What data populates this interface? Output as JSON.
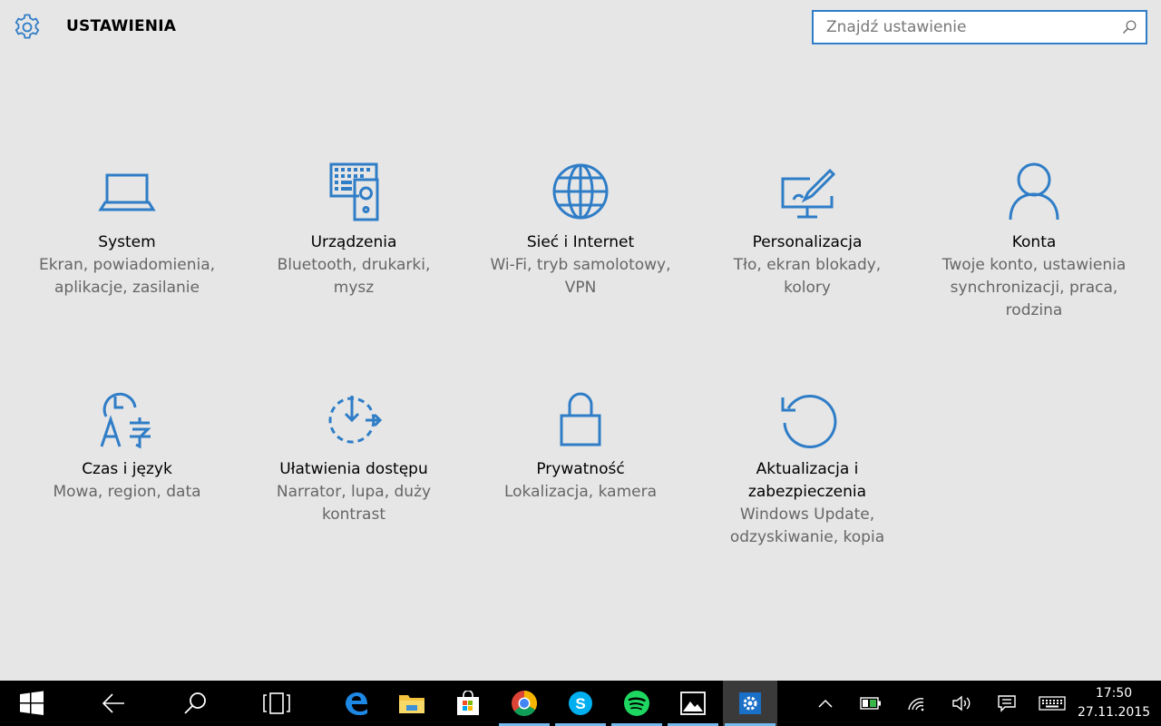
{
  "header": {
    "title": "USTAWIENIA",
    "search_placeholder": "Znajdź ustawienie"
  },
  "colors": {
    "accent": "#2f7dc7",
    "background": "#e6e6e6",
    "taskbar": "#000000",
    "active_indicator": "#76b9ed"
  },
  "categories": [
    {
      "name": "System",
      "desc1": "Ekran, powiadomienia,",
      "desc2": "aplikacje, zasilanie",
      "desc3": "",
      "icon": "laptop-icon"
    },
    {
      "name": "Urządzenia",
      "desc1": "Bluetooth, drukarki,",
      "desc2": "mysz",
      "desc3": "",
      "icon": "devices-icon"
    },
    {
      "name": "Sieć i Internet",
      "desc1": "Wi-Fi, tryb samolotowy,",
      "desc2": "VPN",
      "desc3": "",
      "icon": "globe-icon"
    },
    {
      "name": "Personalizacja",
      "desc1": "Tło, ekran blokady,",
      "desc2": "kolory",
      "desc3": "",
      "icon": "personalize-icon"
    },
    {
      "name": "Konta",
      "desc1": "Twoje konto, ustawienia",
      "desc2": "synchronizacji, praca,",
      "desc3": "rodzina",
      "icon": "person-icon"
    },
    {
      "name": "Czas i język",
      "desc1": "Mowa, region, data",
      "desc2": "",
      "desc3": "",
      "icon": "time-language-icon"
    },
    {
      "name": "Ułatwienia dostępu",
      "desc1": "Narrator, lupa, duży",
      "desc2": "kontrast",
      "desc3": "",
      "icon": "ease-of-access-icon"
    },
    {
      "name": "Prywatność",
      "desc1": "Lokalizacja, kamera",
      "desc2": "",
      "desc3": "",
      "icon": "lock-icon"
    },
    {
      "name1": "Aktualizacja i",
      "name2": "zabezpieczenia",
      "desc1": "Windows Update,",
      "desc2": "odzyskiwanie, kopia",
      "desc3": "",
      "icon": "update-icon"
    }
  ],
  "taskbar": {
    "apps": [
      "start-icon",
      "back-icon",
      "search-icon",
      "task-view-icon",
      "edge-icon",
      "file-explorer-icon",
      "store-icon",
      "chrome-icon",
      "skype-icon",
      "spotify-icon",
      "photos-icon",
      "settings-icon"
    ],
    "time": "17:50",
    "date": "27.11.2015"
  }
}
